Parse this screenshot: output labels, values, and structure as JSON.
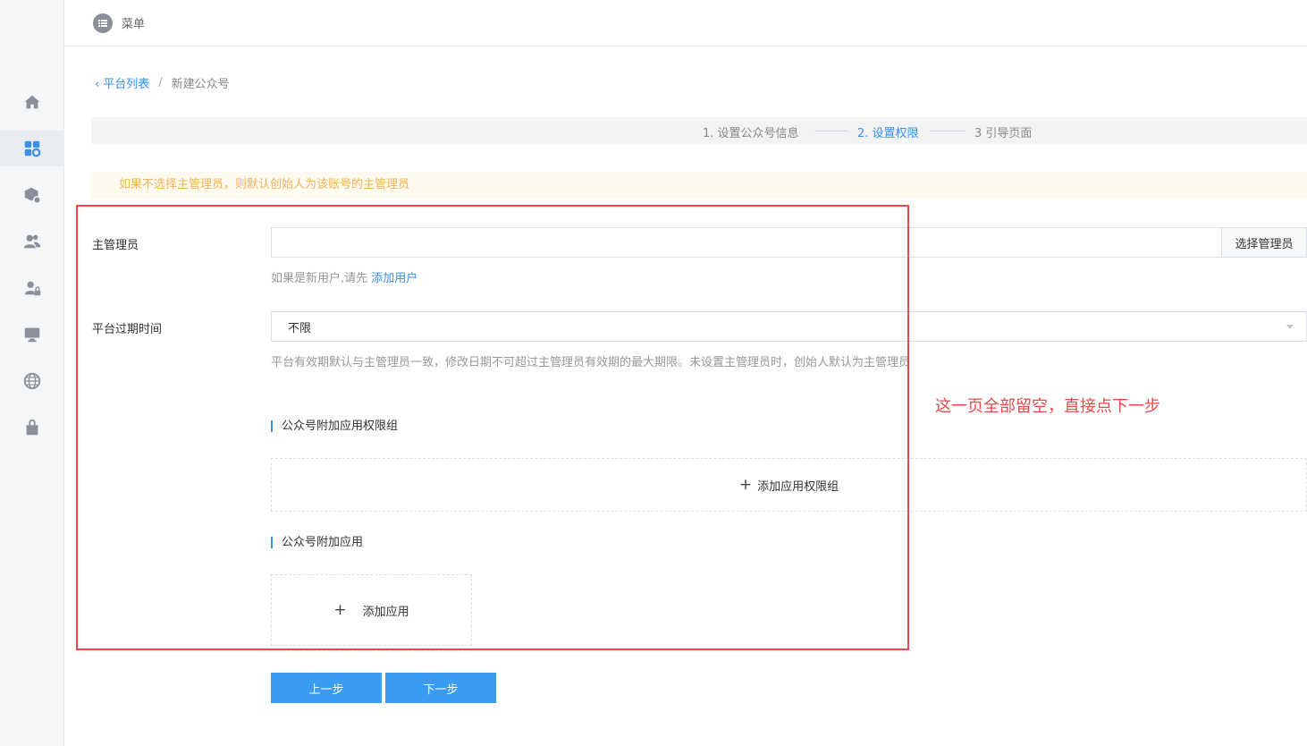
{
  "topbar": {
    "menu_label": "菜单"
  },
  "sidebar": {
    "items": [
      {
        "icon": "home-icon"
      },
      {
        "icon": "apps-icon",
        "active": true
      },
      {
        "icon": "package-settings-icon"
      },
      {
        "icon": "users-icon"
      },
      {
        "icon": "user-lock-icon"
      },
      {
        "icon": "monitor-icon"
      },
      {
        "icon": "globe-icon"
      },
      {
        "icon": "bag-icon"
      }
    ]
  },
  "breadcrumb": {
    "back_label": "平台列表",
    "separator": "/",
    "current": "新建公众号"
  },
  "steps": [
    {
      "label": "1. 设置公众号信息",
      "active": false
    },
    {
      "label": "2. 设置权限",
      "active": true
    },
    {
      "label": "3 引导页面",
      "active": false
    }
  ],
  "notice": "如果不选择主管理员，则默认创始人为该账号的主管理员",
  "form": {
    "admin_label": "主管理员",
    "admin_value": "",
    "admin_button": "选择管理员",
    "admin_hint_prefix": "如果是新用户,请先",
    "admin_hint_link": "添加用户",
    "expire_label": "平台过期时间",
    "expire_value": "不限",
    "expire_hint": "平台有效期默认与主管理员一致，修改日期不可超过主管理员有效期的最大期限。未设置主管理员时，创始人默认为主管理员"
  },
  "perm_group": {
    "title": "公众号附加应用权限组",
    "add_label": "添加应用权限组",
    "add_icon": "plus-icon"
  },
  "apps": {
    "title": "公众号附加应用",
    "add_label": "添加应用",
    "add_icon": "plus-icon"
  },
  "buttons": {
    "prev": "上一步",
    "next": "下一步"
  },
  "annotation": "这一页全部留空，直接点下一步",
  "colors": {
    "accent": "#3a8ee6",
    "button": "#3a9cf0",
    "notice_text": "#f0b45a",
    "annotation_red": "#e54c4c"
  }
}
